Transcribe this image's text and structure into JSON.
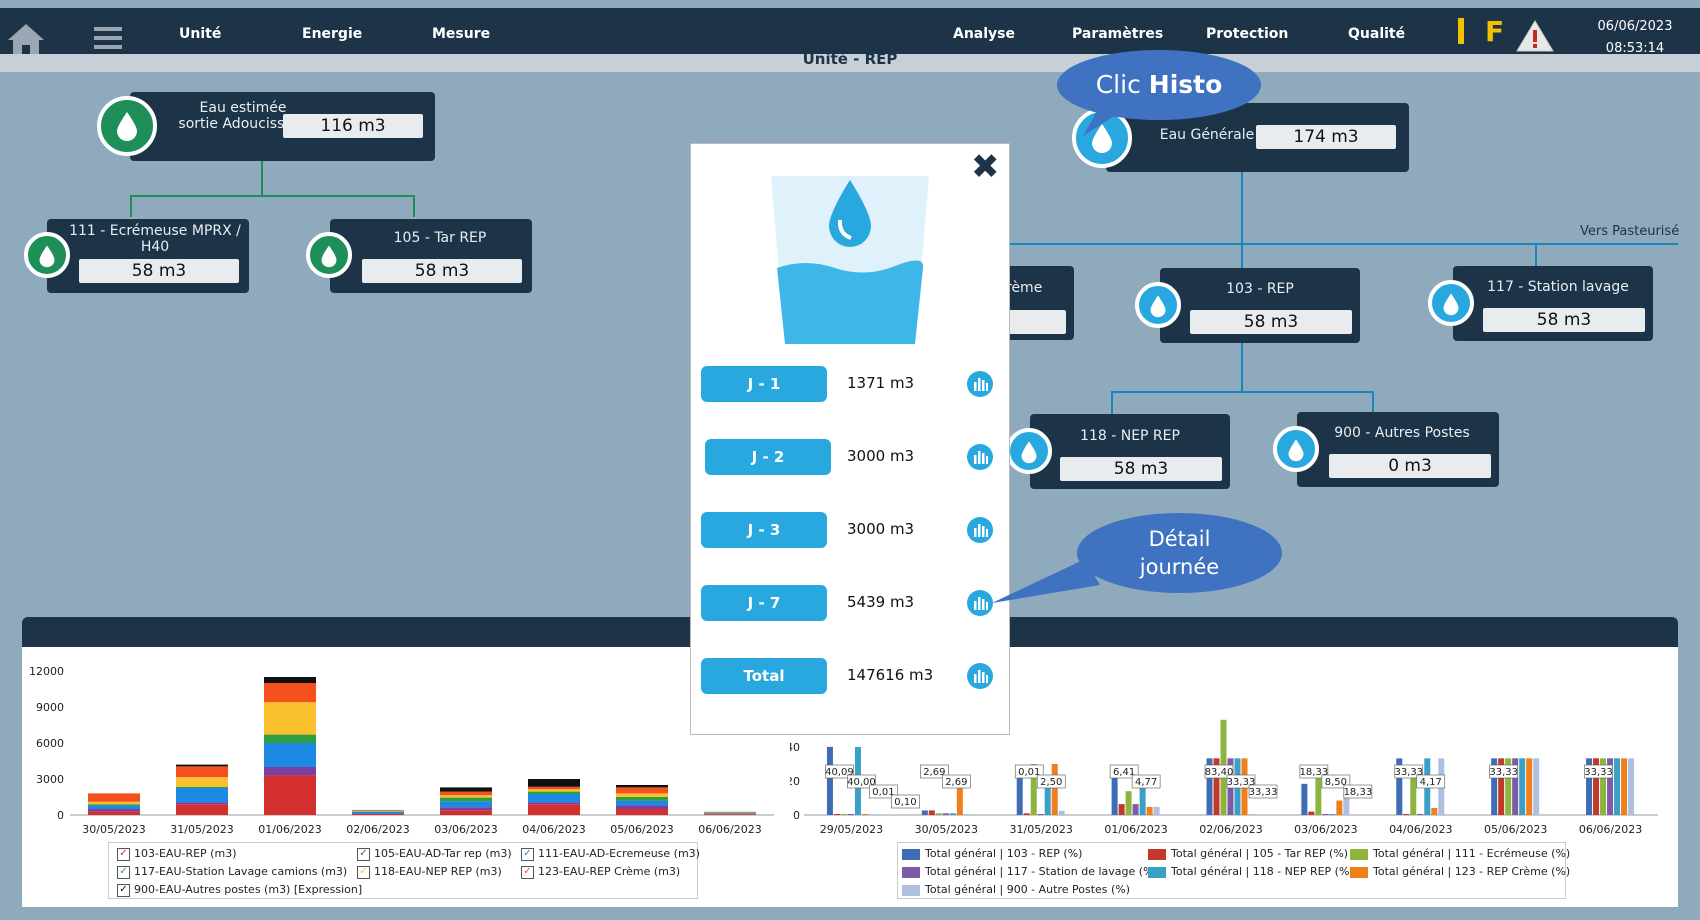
{
  "nav": {
    "unite": "Unité",
    "energie": "Energie",
    "mesure": "Mesure",
    "analyse": "Analyse",
    "parametres": "Paramètres",
    "protection": "Protection",
    "qualite": "Qualité"
  },
  "indicators": {
    "f": "F"
  },
  "datetime": {
    "date": "06/06/2023",
    "time": "08:53:14"
  },
  "subtitle": "Unité - REP",
  "nodes": {
    "eau_estimee": {
      "label": "Eau estimée sortie Adoucisseur",
      "value": "116 m3"
    },
    "ecremeuse": {
      "label": "111 - Ecrémeuse MPRX / H40",
      "value": "58 m3"
    },
    "tar_rep": {
      "label": "105 - Tar REP",
      "value": "58 m3"
    },
    "eau_generale": {
      "label": "Eau Générale",
      "value": "174 m3"
    },
    "creme": {
      "label": "rème"
    },
    "rep103": {
      "label": "103 - REP",
      "value": "58 m3"
    },
    "station_lavage": {
      "label": "117 - Station lavage",
      "value": "58 m3"
    },
    "nep118": {
      "label": "118 - NEP REP",
      "value": "58 m3"
    },
    "autres900": {
      "label": "900 - Autres Postes",
      "value": "0 m3"
    }
  },
  "vers_pasteurise": "Vers Pasteurisé",
  "bubbles": {
    "histo_prefix": "Clic ",
    "histo_bold": "Histo",
    "detail_1": "Détail",
    "detail_2": "journée"
  },
  "modal": {
    "close": "✖",
    "rows": [
      {
        "label": "J - 1",
        "value": "1371 m3"
      },
      {
        "label": "J - 2",
        "value": "3000 m3"
      },
      {
        "label": "J - 3",
        "value": "3000 m3"
      },
      {
        "label": "J - 7",
        "value": "5439 m3"
      },
      {
        "label": "Total",
        "value": "147616 m3"
      }
    ]
  },
  "colors": {
    "navy": "#1d3448",
    "accent": "#29a8e0",
    "green_drop": "#1f8f5a",
    "blue_drop": "#29a8e0"
  },
  "legend_left": [
    {
      "label": "103-EAU-REP (m3)",
      "color": "#d32f2f"
    },
    {
      "label": "105-EAU-AD-Tar rep (m3)",
      "color": "#7b3fa0"
    },
    {
      "label": "111-EAU-AD-Ecremeuse (m3)",
      "color": "#1e88e5"
    },
    {
      "label": "117-EAU-Station Lavage camions (m3)",
      "color": "#2e9e3e"
    },
    {
      "label": "118-EAU-NEP REP (m3)",
      "color": "#fbc02d"
    },
    {
      "label": "123-EAU-REP Crème (m3)",
      "color": "#f4511e"
    },
    {
      "label": "900-EAU-Autres postes (m3) [Expression]",
      "color": "#111111"
    }
  ],
  "legend_right": [
    {
      "label": "Total général | 103 - REP (%)",
      "color": "#3e6db5"
    },
    {
      "label": "Total général | 105 - Tar REP (%)",
      "color": "#c0392b"
    },
    {
      "label": "Total général | 111 - Ecrémeuse (%)",
      "color": "#8db53e"
    },
    {
      "label": "Total général | 117 - Station de lavage (%)",
      "color": "#7d5ba6"
    },
    {
      "label": "Total général | 118 - NEP REP (%)",
      "color": "#3aa0c8"
    },
    {
      "label": "Total général | 123 - REP Crème (%)",
      "color": "#f07f1b"
    },
    {
      "label": "Total général | 900 - Autre Postes (%)",
      "color": "#aebfe0"
    }
  ],
  "chart_data": [
    {
      "type": "bar",
      "stacked": true,
      "categories": [
        "30/05/2023",
        "31/05/2023",
        "01/06/2023",
        "02/06/2023",
        "03/06/2023",
        "04/06/2023",
        "05/06/2023",
        "06/06/2023"
      ],
      "ylim": [
        0,
        12000
      ],
      "yticks": [
        0,
        3000,
        6000,
        9000,
        12000
      ],
      "series": [
        {
          "name": "103-EAU-REP (m3)",
          "values": [
            300,
            900,
            3300,
            80,
            400,
            900,
            500,
            60
          ]
        },
        {
          "name": "105-EAU-AD-Tar rep (m3)",
          "values": [
            200,
            150,
            700,
            40,
            250,
            150,
            300,
            30
          ]
        },
        {
          "name": "111-EAU-AD-Ecremeuse (m3)",
          "values": [
            300,
            1200,
            2000,
            150,
            500,
            700,
            400,
            50
          ]
        },
        {
          "name": "117-EAU-Station Lavage camions (m3)",
          "values": [
            100,
            100,
            700,
            40,
            300,
            200,
            300,
            30
          ]
        },
        {
          "name": "118-EAU-NEP REP (m3)",
          "values": [
            200,
            800,
            2700,
            50,
            200,
            200,
            300,
            30
          ]
        },
        {
          "name": "123-EAU-REP Crème (m3)",
          "values": [
            700,
            900,
            1600,
            40,
            300,
            200,
            500,
            40
          ]
        },
        {
          "name": "900-EAU-Autres postes (m3) [Expression]",
          "values": [
            0,
            150,
            500,
            20,
            350,
            650,
            200,
            20
          ]
        }
      ]
    },
    {
      "type": "bar",
      "categories": [
        "29/05/2023",
        "30/05/2023",
        "31/05/2023",
        "01/06/2023",
        "02/06/2023",
        "03/06/2023",
        "04/06/2023",
        "05/06/2023",
        "06/06/2023"
      ],
      "ylim": [
        0,
        40
      ],
      "yticks": [
        0,
        20,
        40
      ],
      "series": [
        {
          "name": "Total général | 103 - REP (%)",
          "values": [
            40.09,
            2.69,
            22,
            26,
            33.33,
            18.33,
            33.33,
            33.33,
            33.33
          ]
        },
        {
          "name": "Total général | 105 - Tar REP (%)",
          "values": [
            0.5,
            2.69,
            1,
            6.41,
            33.33,
            2,
            0.5,
            33.33,
            33.33
          ]
        },
        {
          "name": "Total général | 111 - Ecrémeuse (%)",
          "values": [
            0.5,
            1,
            30,
            14,
            83.4,
            24,
            26,
            33.33,
            33.33
          ]
        },
        {
          "name": "Total général | 117 - Station de lavage (%)",
          "values": [
            0.5,
            1,
            0.01,
            6.41,
            33.33,
            0.5,
            0.5,
            33.33,
            33.33
          ]
        },
        {
          "name": "Total général | 118 - NEP REP (%)",
          "values": [
            40.0,
            1,
            20,
            20,
            33.33,
            0.5,
            33.33,
            33.33,
            33.33
          ]
        },
        {
          "name": "Total général | 123 - REP Crème (%)",
          "values": [
            0.01,
            20,
            30,
            4.77,
            33.33,
            8.5,
            4.17,
            33.33,
            33.33
          ]
        },
        {
          "name": "Total général | 900 - Autre Postes (%)",
          "values": [
            0.1,
            0.5,
            2.5,
            4.77,
            0.5,
            18.33,
            33.33,
            33.33,
            33.33
          ]
        }
      ],
      "data_labels": [
        {
          "category": "29/05/2023",
          "texts": [
            "40,09",
            "40,00",
            "0,01",
            "0,10"
          ]
        },
        {
          "category": "30/05/2023",
          "texts": [
            "2,69",
            "2,69"
          ]
        },
        {
          "category": "31/05/2023",
          "texts": [
            "0,01",
            "2,50"
          ]
        },
        {
          "category": "01/06/2023",
          "texts": [
            "6,41",
            "4,77"
          ]
        },
        {
          "category": "02/06/2023",
          "texts": [
            "83,40",
            "33,33",
            "33,33"
          ]
        },
        {
          "category": "03/06/2023",
          "texts": [
            "18,33",
            "8,50",
            "18,33"
          ]
        },
        {
          "category": "04/06/2023",
          "texts": [
            "33,33",
            "4,17"
          ]
        },
        {
          "category": "05/06/2023",
          "texts": [
            "33,33"
          ]
        },
        {
          "category": "06/06/2023",
          "texts": [
            "33,33"
          ]
        }
      ]
    }
  ]
}
